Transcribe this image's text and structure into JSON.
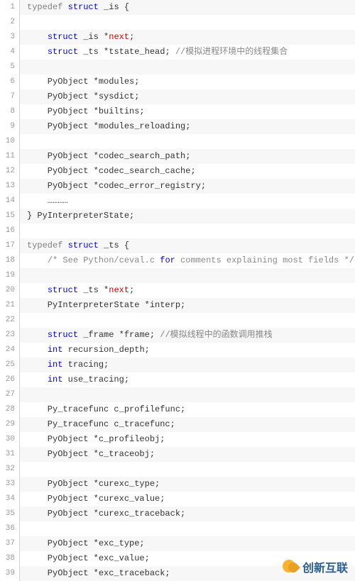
{
  "code": {
    "lines": [
      {
        "num": 1,
        "segments": [
          {
            "t": "typedef",
            "c": "kw-typedef"
          },
          {
            "t": " "
          },
          {
            "t": "struct",
            "c": "kw-struct"
          },
          {
            "t": " _is {"
          }
        ]
      },
      {
        "num": 2,
        "segments": []
      },
      {
        "num": 3,
        "segments": [
          {
            "t": "    "
          },
          {
            "t": "struct",
            "c": "kw-struct"
          },
          {
            "t": " _is *"
          },
          {
            "t": "next",
            "c": "ptr"
          },
          {
            "t": ";"
          }
        ]
      },
      {
        "num": 4,
        "segments": [
          {
            "t": "    "
          },
          {
            "t": "struct",
            "c": "kw-struct"
          },
          {
            "t": " _ts *tstate_head; "
          },
          {
            "t": "//模拟进程环境中的线程集合",
            "c": "comment"
          }
        ]
      },
      {
        "num": 5,
        "segments": []
      },
      {
        "num": 6,
        "segments": [
          {
            "t": "    PyObject *modules;"
          }
        ]
      },
      {
        "num": 7,
        "segments": [
          {
            "t": "    PyObject *sysdict;"
          }
        ]
      },
      {
        "num": 8,
        "segments": [
          {
            "t": "    PyObject *builtins;"
          }
        ]
      },
      {
        "num": 9,
        "segments": [
          {
            "t": "    PyObject *modules_reloading;"
          }
        ]
      },
      {
        "num": 10,
        "segments": []
      },
      {
        "num": 11,
        "segments": [
          {
            "t": "    PyObject *codec_search_path;"
          }
        ]
      },
      {
        "num": 12,
        "segments": [
          {
            "t": "    PyObject *codec_search_cache;"
          }
        ]
      },
      {
        "num": 13,
        "segments": [
          {
            "t": "    PyObject *codec_error_registry;"
          }
        ]
      },
      {
        "num": 14,
        "segments": [
          {
            "t": "    …………"
          }
        ]
      },
      {
        "num": 15,
        "segments": [
          {
            "t": "} PyInterpreterState;"
          }
        ]
      },
      {
        "num": 16,
        "segments": []
      },
      {
        "num": 17,
        "segments": [
          {
            "t": "typedef",
            "c": "kw-typedef"
          },
          {
            "t": " "
          },
          {
            "t": "struct",
            "c": "kw-struct"
          },
          {
            "t": " _ts {"
          }
        ]
      },
      {
        "num": 18,
        "segments": [
          {
            "t": "    "
          },
          {
            "t": "/* See Python/ceval.c ",
            "c": "comment"
          },
          {
            "t": "for",
            "c": "kw-for"
          },
          {
            "t": " comments explaining most fields */",
            "c": "comment"
          }
        ]
      },
      {
        "num": 19,
        "segments": []
      },
      {
        "num": 20,
        "segments": [
          {
            "t": "    "
          },
          {
            "t": "struct",
            "c": "kw-struct"
          },
          {
            "t": " _ts *"
          },
          {
            "t": "next",
            "c": "ptr"
          },
          {
            "t": ";"
          }
        ]
      },
      {
        "num": 21,
        "segments": [
          {
            "t": "    PyInterpreterState *interp;"
          }
        ]
      },
      {
        "num": 22,
        "segments": []
      },
      {
        "num": 23,
        "segments": [
          {
            "t": "    "
          },
          {
            "t": "struct",
            "c": "kw-struct"
          },
          {
            "t": " _frame *frame; "
          },
          {
            "t": "//模拟线程中的函数调用推栈",
            "c": "comment"
          }
        ]
      },
      {
        "num": 24,
        "segments": [
          {
            "t": "    "
          },
          {
            "t": "int",
            "c": "kw-int"
          },
          {
            "t": " recursion_depth;"
          }
        ]
      },
      {
        "num": 25,
        "segments": [
          {
            "t": "    "
          },
          {
            "t": "int",
            "c": "kw-int"
          },
          {
            "t": " tracing;"
          }
        ]
      },
      {
        "num": 26,
        "segments": [
          {
            "t": "    "
          },
          {
            "t": "int",
            "c": "kw-int"
          },
          {
            "t": " use_tracing;"
          }
        ]
      },
      {
        "num": 27,
        "segments": []
      },
      {
        "num": 28,
        "segments": [
          {
            "t": "    Py_tracefunc c_profilefunc;"
          }
        ]
      },
      {
        "num": 29,
        "segments": [
          {
            "t": "    Py_tracefunc c_tracefunc;"
          }
        ]
      },
      {
        "num": 30,
        "segments": [
          {
            "t": "    PyObject *c_profileobj;"
          }
        ]
      },
      {
        "num": 31,
        "segments": [
          {
            "t": "    PyObject *c_traceobj;"
          }
        ]
      },
      {
        "num": 32,
        "segments": []
      },
      {
        "num": 33,
        "segments": [
          {
            "t": "    PyObject *curexc_type;"
          }
        ]
      },
      {
        "num": 34,
        "segments": [
          {
            "t": "    PyObject *curexc_value;"
          }
        ]
      },
      {
        "num": 35,
        "segments": [
          {
            "t": "    PyObject *curexc_traceback;"
          }
        ]
      },
      {
        "num": 36,
        "segments": []
      },
      {
        "num": 37,
        "segments": [
          {
            "t": "    PyObject *exc_type;"
          }
        ]
      },
      {
        "num": 38,
        "segments": [
          {
            "t": "    PyObject *exc_value;"
          }
        ]
      },
      {
        "num": 39,
        "segments": [
          {
            "t": "    PyObject *exc_traceback;"
          }
        ]
      }
    ]
  },
  "watermark": {
    "text": "创新互联"
  }
}
